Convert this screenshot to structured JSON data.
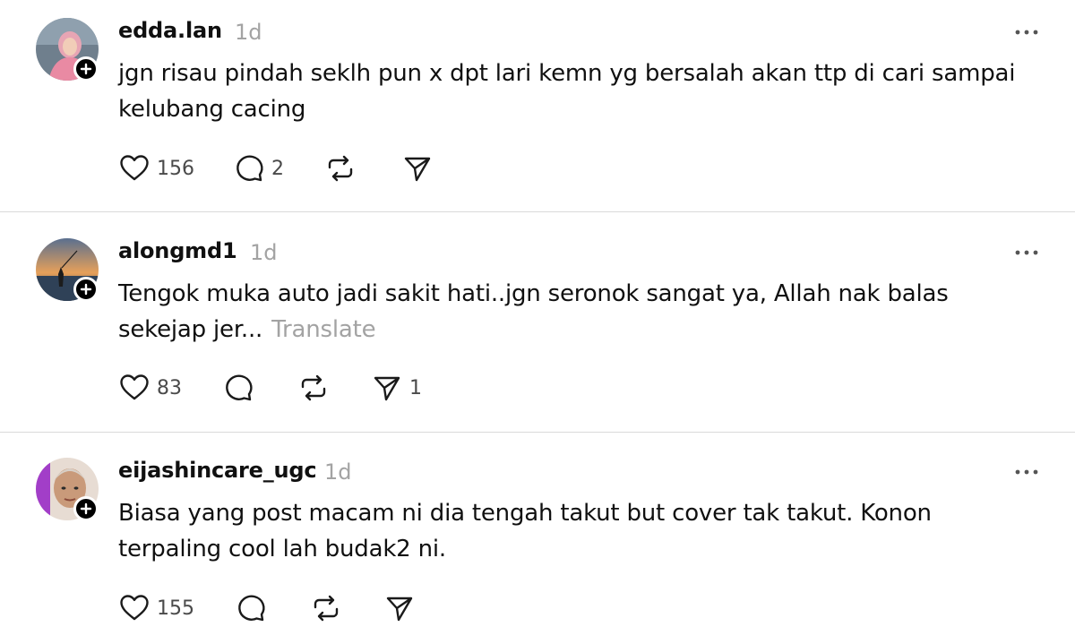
{
  "posts": [
    {
      "username": "edda.lan",
      "time": "1d",
      "text": "jgn risau pindah seklh pun x dpt lari kemn yg bersalah akan ttp di cari sampai kelubang cacing",
      "translate": "",
      "likes": "156",
      "replies": "2",
      "reposts": "",
      "shares": ""
    },
    {
      "username": "alongmd1",
      "time": "1d",
      "text": "Tengok muka auto jadi sakit hati..jgn seronok sangat ya, Allah nak balas sekejap jer...",
      "translate": "Translate",
      "likes": "83",
      "replies": "",
      "reposts": "",
      "shares": "1"
    },
    {
      "username": "eijashincare_ugc",
      "time": "1d",
      "text": "Biasa yang post macam ni dia tengah takut but cover tak takut. Konon terpaling cool lah budak2 ni.",
      "translate": "",
      "likes": "155",
      "replies": "",
      "reposts": "",
      "shares": ""
    }
  ],
  "icons": {
    "like": "heart-icon",
    "reply": "comment-bubble-icon",
    "repost": "repost-arrows-icon",
    "share": "send-paper-plane-icon",
    "more": "more-dots-icon",
    "follow": "follow-plus-icon"
  },
  "colors": {
    "text": "#101010",
    "muted": "#a3a3a3",
    "divider": "#dadada"
  }
}
